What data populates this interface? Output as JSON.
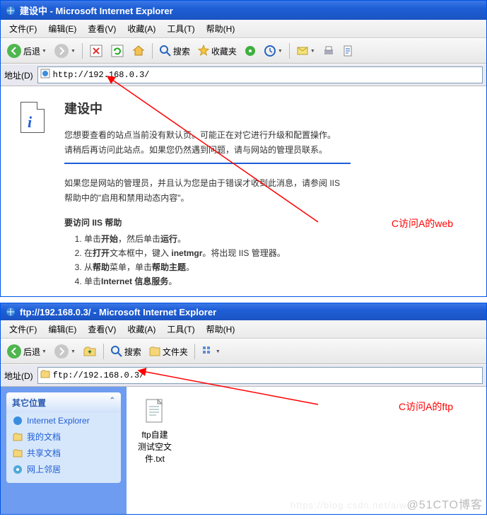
{
  "window1": {
    "title": "建设中 - Microsoft Internet Explorer",
    "menu": [
      "文件(F)",
      "编辑(E)",
      "查看(V)",
      "收藏(A)",
      "工具(T)",
      "帮助(H)"
    ],
    "back": "后退",
    "search": "搜索",
    "favorites": "收藏夹",
    "address_label": "地址(D)",
    "address_value": "http://192.168.0.3/"
  },
  "doc": {
    "h": "建设中",
    "p1": "您想要查看的站点当前没有默认页。可能正在对它进行升级和配置操作。",
    "p2": "请稍后再访问此站点。如果您仍然遇到问题，请与网站的管理员联系。",
    "p3a": "如果您是网站的管理员，并且认为您是由于错误才收到此消息，请参阅 IIS",
    "p3b": "帮助中的\"启用和禁用动态内容\"。",
    "h2": "要访问 IIS 帮助",
    "li1a": "单击",
    "li1b": "开始",
    "li1c": "，然后单击",
    "li1d": "运行",
    "li1e": "。",
    "li2a": "在",
    "li2b": "打开",
    "li2c": "文本框中，键入 ",
    "li2d": "inetmgr",
    "li2e": "。将出现 IIS 管理器。",
    "li3a": "从",
    "li3b": "帮助",
    "li3c": "菜单，单击",
    "li3d": "帮助主题",
    "li3e": "。",
    "li4a": "单击",
    "li4b": "Internet 信息服务",
    "li4e": "。"
  },
  "annot1": "C访问A的web",
  "window2": {
    "title": "ftp://192.168.0.3/ - Microsoft Internet Explorer",
    "menu": [
      "文件(F)",
      "编辑(E)",
      "查看(V)",
      "收藏(A)",
      "工具(T)",
      "帮助(H)"
    ],
    "back": "后退",
    "search": "搜索",
    "folders": "文件夹",
    "address_label": "地址(D)",
    "address_value": "ftp://192.168.0.3/"
  },
  "sidebar": {
    "header": "其它位置",
    "items": [
      "Internet Explorer",
      "我的文档",
      "共享文档",
      "网上邻居"
    ]
  },
  "file": {
    "name": "ftp自建测试空文件.txt"
  },
  "annot2": "C访问A的ftp",
  "watermark": {
    "faint": "https://blog.csdn.net/aiw",
    "main": "@51CTO博客"
  }
}
